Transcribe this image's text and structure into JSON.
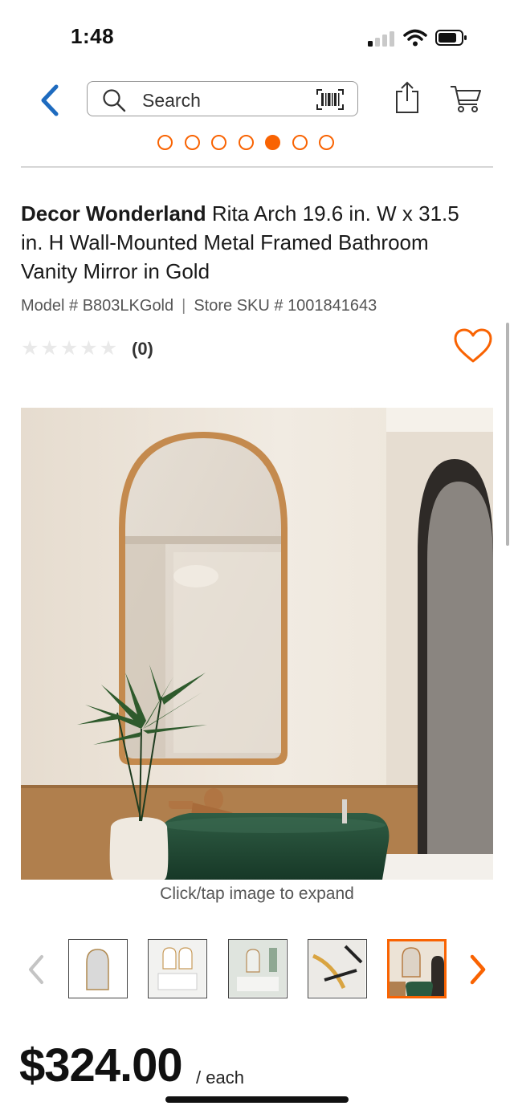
{
  "status_bar": {
    "time": "1:48",
    "signal_bars_filled": 1
  },
  "nav": {
    "back_icon": "chevron-left-icon",
    "search_placeholder": "Search",
    "search_icon": "search-icon",
    "barcode_icon": "barcode-scanner-icon",
    "share_icon": "share-icon",
    "cart_icon": "cart-icon"
  },
  "carousel_dots": {
    "count": 7,
    "active_index": 4
  },
  "product": {
    "brand": "Decor Wonderland",
    "title": " Rita Arch 19.6 in. W x 31.5 in. H Wall-Mounted Metal Framed Bathroom Vanity Mirror in Gold",
    "model_label": "Model # B803LKGold",
    "separator": "|",
    "sku_label": "Store SKU # 1001841643",
    "rating_stars": 0,
    "rating_count": "(0)",
    "favorite_icon": "heart-icon",
    "image_caption": "Click/tap image to expand",
    "price": "$324.00",
    "price_unit": "/ each"
  },
  "thumbnails": {
    "prev_icon": "chevron-left-icon",
    "next_icon": "chevron-right-icon",
    "items": [
      {
        "name": "mirror-only"
      },
      {
        "name": "bathroom-white-vanity"
      },
      {
        "name": "bathroom-double-mirror"
      },
      {
        "name": "frame-detail"
      },
      {
        "name": "bathroom-green-sink"
      }
    ],
    "selected_index": 4
  },
  "colors": {
    "accent": "#f96302",
    "link_blue": "#1e6bbf"
  }
}
